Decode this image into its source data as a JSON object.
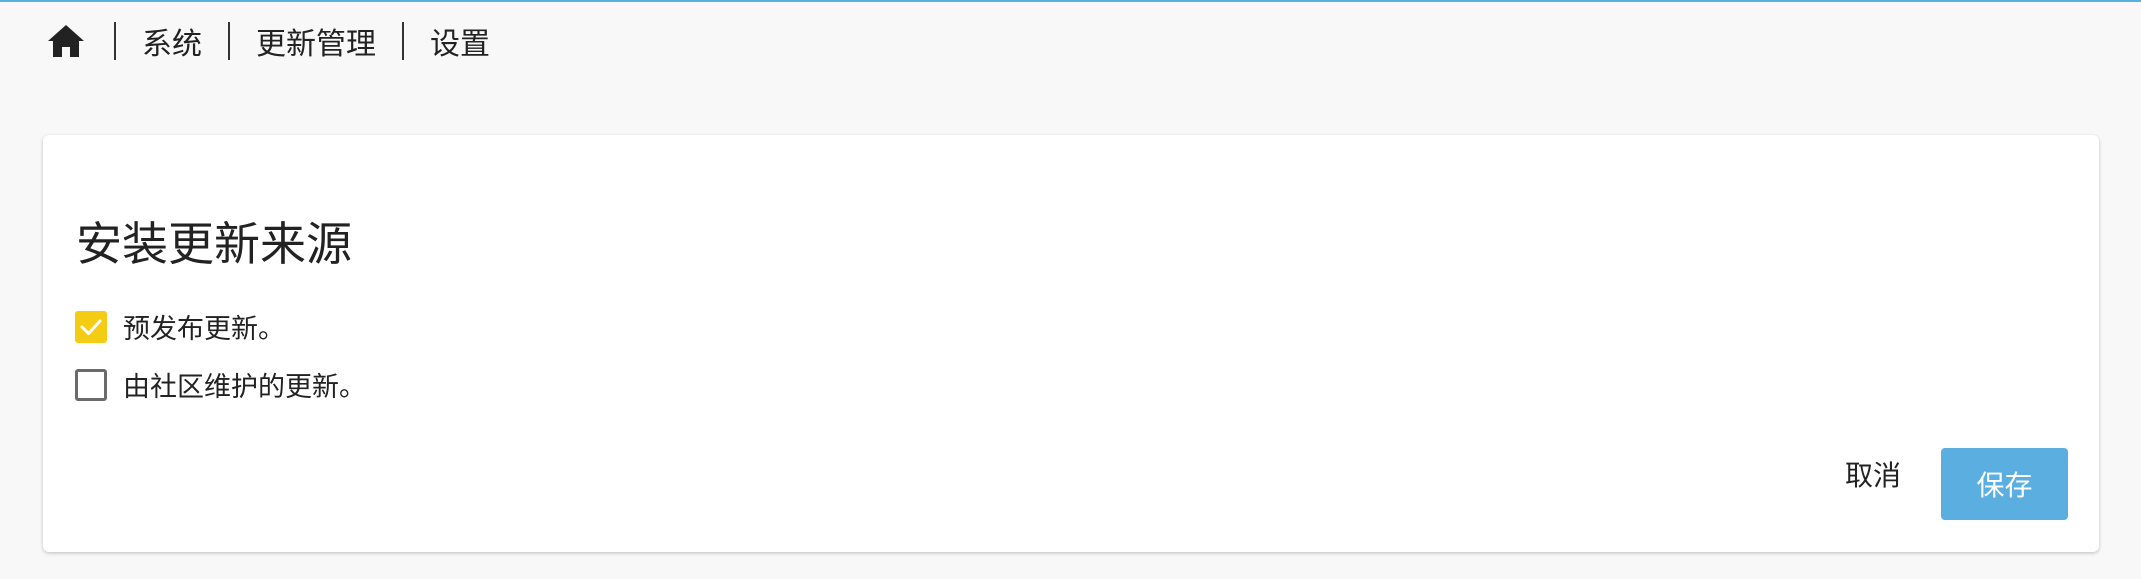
{
  "breadcrumb": {
    "home_icon": "home-icon",
    "items": [
      "系统",
      "更新管理",
      "设置"
    ]
  },
  "card": {
    "title": "安装更新来源",
    "options": [
      {
        "label": "预发布更新。",
        "checked": true
      },
      {
        "label": "由社区维护的更新。",
        "checked": false
      }
    ],
    "cancel_label": "取消",
    "save_label": "保存"
  },
  "colors": {
    "accent": "#5aaee0",
    "checkbox_checked": "#f5cc14",
    "checkbox_border": "#6b6b6b"
  }
}
